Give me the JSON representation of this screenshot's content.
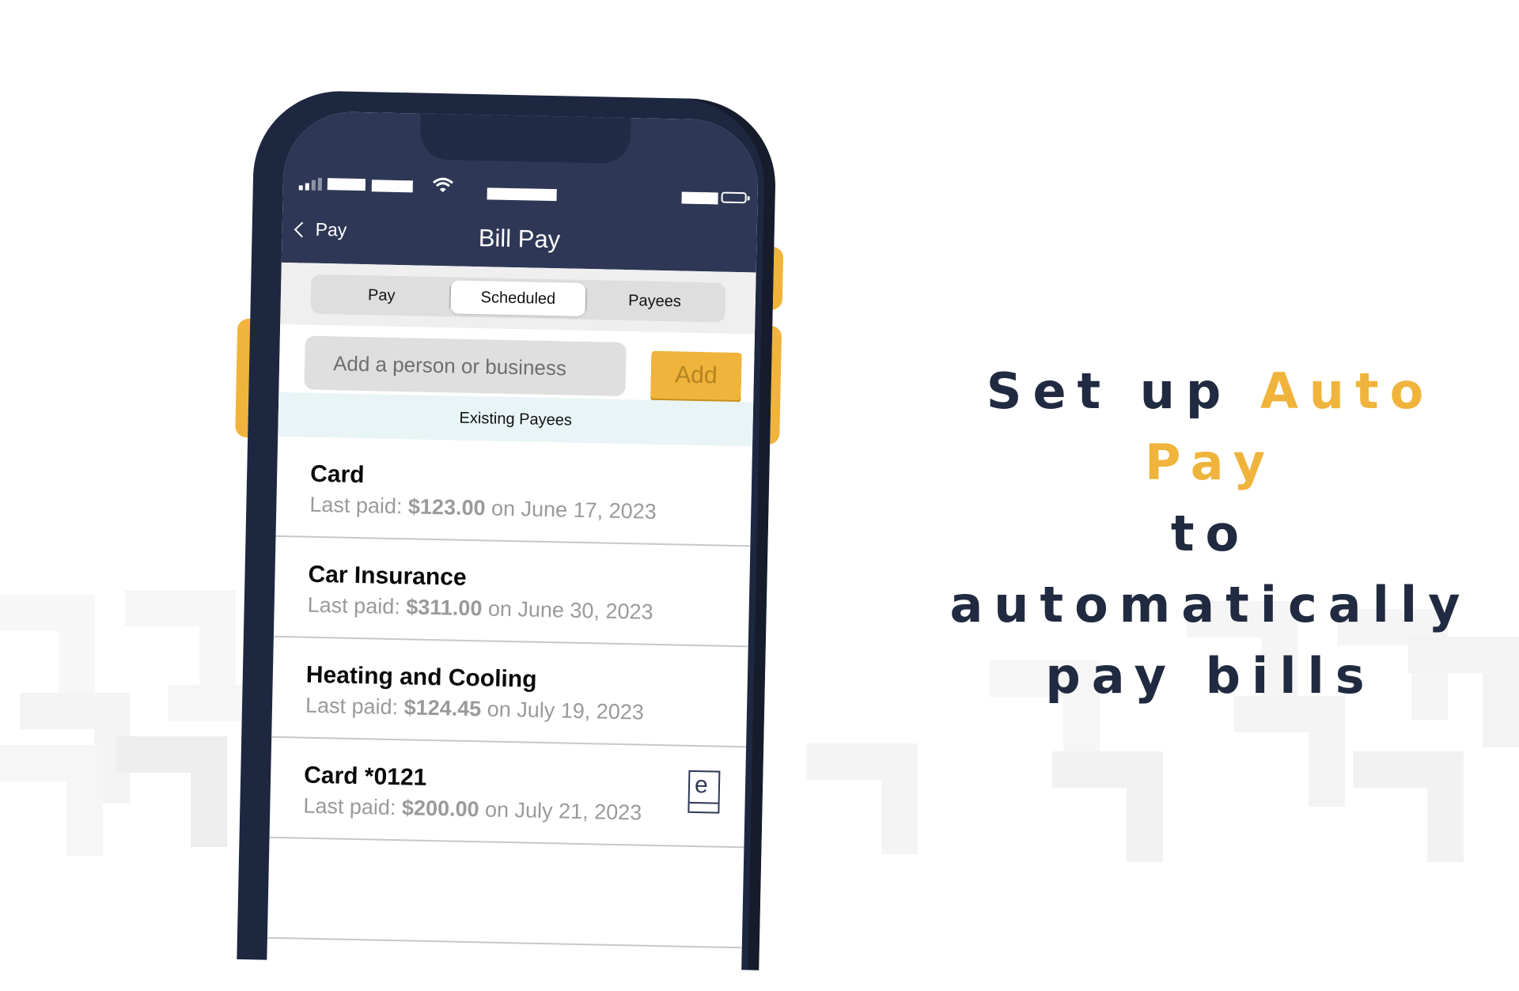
{
  "colors": {
    "navy": "#2e3856",
    "navy_dark": "#1e2740",
    "accent_yellow": "#f0b43c",
    "info_band": "#e8f4f6"
  },
  "status_bar": {
    "signal_icon": "signal-bars-icon",
    "wifi_icon": "wifi-icon",
    "battery_icon": "battery-icon"
  },
  "nav": {
    "back_label": "Pay",
    "back_icon": "chevron-left-icon",
    "title": "Bill Pay"
  },
  "tabs": [
    {
      "label": "Pay",
      "active": false
    },
    {
      "label": "Scheduled",
      "active": true
    },
    {
      "label": "Payees",
      "active": false
    }
  ],
  "search": {
    "placeholder": "Add a person or business",
    "value": "",
    "add_label": "Add"
  },
  "section_label": "Existing Payees",
  "payees": [
    {
      "name": "Card",
      "prefix": "Last paid:",
      "amount": "$123.00",
      "date": "on June 17, 2023",
      "ebill": false
    },
    {
      "name": "Car Insurance",
      "prefix": "Last paid:",
      "amount": "$311.00",
      "date": "on June 30, 2023",
      "ebill": false
    },
    {
      "name": "Heating and Cooling",
      "prefix": "Last paid:",
      "amount": "$124.45",
      "date": "on July 19, 2023",
      "ebill": false
    },
    {
      "name": "Card *0121",
      "prefix": "Last paid:",
      "amount": "$200.00",
      "date": "on July 21, 2023",
      "ebill": true,
      "ebill_glyph": "e"
    }
  ],
  "headline": {
    "line1_a": "Set up ",
    "line1_accent": "Auto Pay",
    "line2": "to automatically",
    "line3": "pay bills"
  }
}
